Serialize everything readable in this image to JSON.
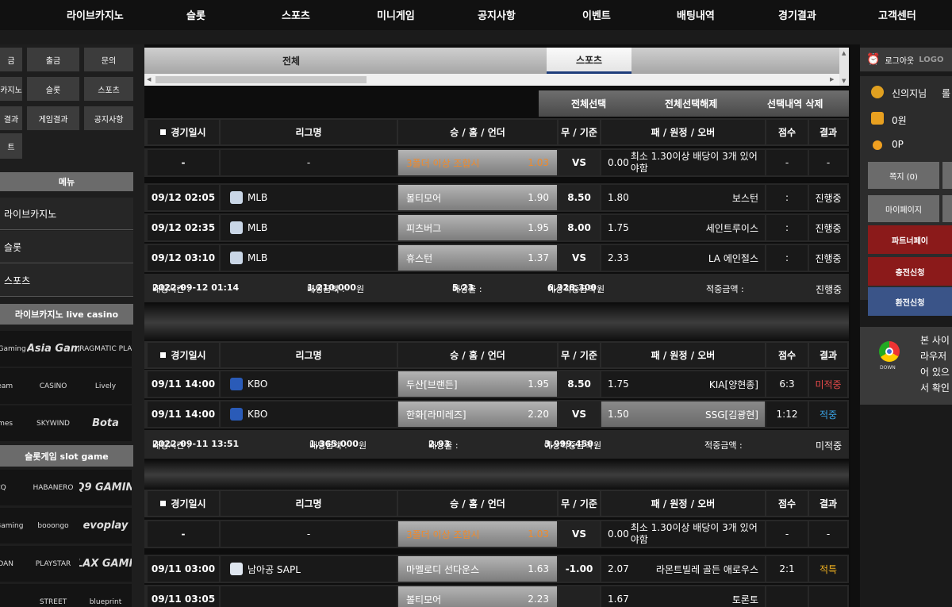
{
  "nav": [
    "라이브카지노",
    "슬롯",
    "스포츠",
    "미니게임",
    "공지사항",
    "이벤트",
    "배팅내역",
    "경기결과",
    "고객센터"
  ],
  "left": {
    "buttons": [
      "금",
      "출금",
      "문의",
      "카지노",
      "슬롯",
      "스포츠",
      "결과",
      "게임결과",
      "공지사항",
      "트"
    ],
    "menu_title": "메뉴",
    "menu_items": [
      "라이브카지노",
      "슬롯",
      "스포츠"
    ],
    "casino_title": "라이브카지노 live casino",
    "casino_logos": [
      "lution Gaming",
      "AG Asia Gaming",
      "PRAGMATIC PLAY",
      "Dream",
      "CASINO",
      "Lively",
      "games",
      "SKYWIND",
      "Bota"
    ],
    "slot_title": "슬롯게임 slot game",
    "slot_logos": [
      "CQ",
      "HABANERO",
      "CQ9 GAMING",
      "Asia Gaming",
      "booongo",
      "evoplay",
      "AZDAN",
      "PLAYSTAR",
      "RELAX GAMING",
      "",
      "STREET",
      "blueprint"
    ]
  },
  "tabs": {
    "all": "전체",
    "sports": "스포츠"
  },
  "actions": {
    "select_all": "전체선택",
    "deselect_all": "전체선택해제",
    "delete_selected": "선택내역 삭제"
  },
  "headers": {
    "date": "경기일시",
    "league": "리그명",
    "home": "승 / 홈 / 언더",
    "draw": "무 / 기준",
    "away": "패 / 원정 / 오버",
    "score": "점수",
    "result": "결과"
  },
  "groups": [
    {
      "bonus": {
        "date": "-",
        "league": "-",
        "home": "3폴더 이상 조합시",
        "home_odds": "1.03",
        "draw": "VS",
        "away_odds": "0.00",
        "away": "최소 1.30이상 배당이 3개 있어야함",
        "score": "-",
        "result": "-"
      },
      "rows": [
        {
          "date": "09/12 02:05",
          "league": "MLB",
          "home": "볼티모어",
          "home_odds": "1.90",
          "draw": "8.50",
          "away_odds": "1.80",
          "away": "보스턴",
          "score": ":",
          "result": "진행중"
        },
        {
          "date": "09/12 02:35",
          "league": "MLB",
          "home": "피츠버그",
          "home_odds": "1.95",
          "draw": "8.00",
          "away_odds": "1.75",
          "away": "세인트루이스",
          "score": ":",
          "result": "진행중"
        },
        {
          "date": "09/12 03:10",
          "league": "MLB",
          "home": "휴스턴",
          "home_odds": "1.37",
          "draw": "VS",
          "away_odds": "2.33",
          "away": "LA 에인절스",
          "score": ":",
          "result": "진행중"
        }
      ],
      "summary": {
        "time_label": "배팅시간 :",
        "time": "2022-09-12 01:14",
        "amount_label": "배팅금액 :",
        "amount": "1,210,000",
        "amount_unit": "원",
        "rate_label": "배당율 :",
        "rate": "5.23",
        "expected_label": "예상적중금액 :",
        "expected": "6,328,300",
        "expected_unit": "원",
        "win_label": "적중금액 :",
        "win": "",
        "status": "진행중"
      }
    },
    {
      "rows": [
        {
          "date": "09/11 14:00",
          "league": "KBO",
          "home": "두산[브랜든]",
          "home_odds": "1.95",
          "draw": "8.50",
          "away_odds": "1.75",
          "away": "KIA[양현종]",
          "score": "6:3",
          "result": "미적중"
        },
        {
          "date": "09/11 14:00",
          "league": "KBO",
          "home": "한화[라미레즈]",
          "home_odds": "2.20",
          "draw": "VS",
          "away_odds": "1.50",
          "away": "SSG[김광현]",
          "score": "1:12",
          "result": "적중"
        }
      ],
      "summary": {
        "time_label": "배팅시간 :",
        "time": "2022-09-11 13:51",
        "amount_label": "배팅금액 :",
        "amount": "1,365,000",
        "amount_unit": "원",
        "rate_label": "배당율 :",
        "rate": "2.93",
        "expected_label": "예상적중금액 :",
        "expected": "3,999,450",
        "expected_unit": "원",
        "win_label": "적중금액 :",
        "win": "",
        "status": "미적중"
      }
    },
    {
      "bonus": {
        "date": "-",
        "league": "-",
        "home": "3폴더 이상 조합시",
        "home_odds": "1.03",
        "draw": "VS",
        "away_odds": "0.00",
        "away": "최소 1.30이상 배당이 3개 있어야함",
        "score": "-",
        "result": "-"
      },
      "rows": [
        {
          "date": "09/11 03:00",
          "league": "남아공 SAPL",
          "home": "마멜로디 선다운스",
          "home_odds": "1.63",
          "draw": "-1.00",
          "away_odds": "2.07",
          "away": "라몬트빌레 골든 애로우스",
          "score": "2:1",
          "result": "적특"
        },
        {
          "date": "09/11 03:05",
          "league": "",
          "home": "볼티모어",
          "home_odds": "2.23",
          "draw": "",
          "away_odds": "1.67",
          "away": "토론토",
          "score": "",
          "result": ""
        }
      ]
    }
  ],
  "right": {
    "logout": "로그아웃",
    "logo_text": "LOGO",
    "user": "신의지님",
    "user_extra": "롤",
    "money": "0원",
    "points": "0P",
    "note_btn": "쪽지 (0)",
    "mypage_btn": "마이페이지",
    "partner_btn": "파트너페이",
    "deposit_btn": "충전신청",
    "withdraw_btn": "환전신청",
    "down_label": "DOWN",
    "notice_lines": [
      "본 사이",
      "라우저",
      "어 있으",
      "서 확인"
    ]
  },
  "colors": {
    "red": "#e84a4a",
    "blue": "#3aa5e8",
    "gold": "#f2b220",
    "orange": "#f08a2a",
    "tab_underline": "#1d3c7a"
  }
}
